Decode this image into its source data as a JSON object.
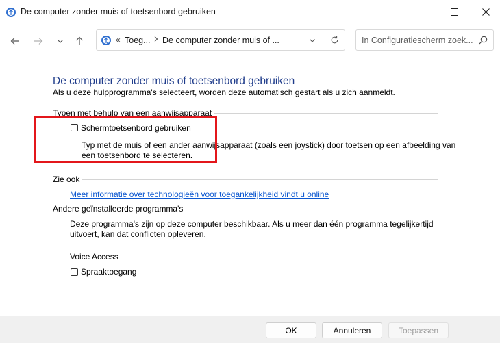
{
  "window": {
    "title": "De computer zonder muis of toetsenbord gebruiken",
    "icon": "control-panel-ease-of-access-icon"
  },
  "address": {
    "overflow": "«",
    "crumb1": "Toeg...",
    "crumb2": "De computer zonder muis of ..."
  },
  "search": {
    "placeholder": "In Configuratiescherm zoek..."
  },
  "main": {
    "heading": "De computer zonder muis of toetsenbord gebruiken",
    "subtitle": "Als u deze hulpprogramma's selecteert, worden deze automatisch gestart als u zich aanmeldt.",
    "section1": {
      "title": "Typen met behulp van een aanwijsapparaat",
      "checkbox_label": "Schermtoetsenbord gebruiken",
      "checked": false,
      "description_line1": "Typ met de muis of een ander aanwijsapparaat (zoals een joystick) door toetsen op een afbeelding van",
      "description_line2": "een toetsenbord te selecteren."
    },
    "see_also": {
      "title": "Zie ook",
      "link": "Meer informatie over technologieën voor toegankelijkheid vindt u online"
    },
    "other_programs": {
      "title": "Andere geïnstalleerde programma's",
      "description_line1": "Deze programma's zijn op deze computer beschikbaar. Als u meer dan één programma tegelijkertijd",
      "description_line2": "uitvoert, kan dat conflicten opleveren.",
      "program_name": "Voice Access",
      "checkbox_label": "Spraaktoegang",
      "checked": false
    }
  },
  "footer": {
    "ok": "OK",
    "cancel": "Annuleren",
    "apply": "Toepassen"
  },
  "colors": {
    "heading": "#1e3b8a",
    "link": "#0b57d0",
    "highlight_box": "#e3161b"
  }
}
